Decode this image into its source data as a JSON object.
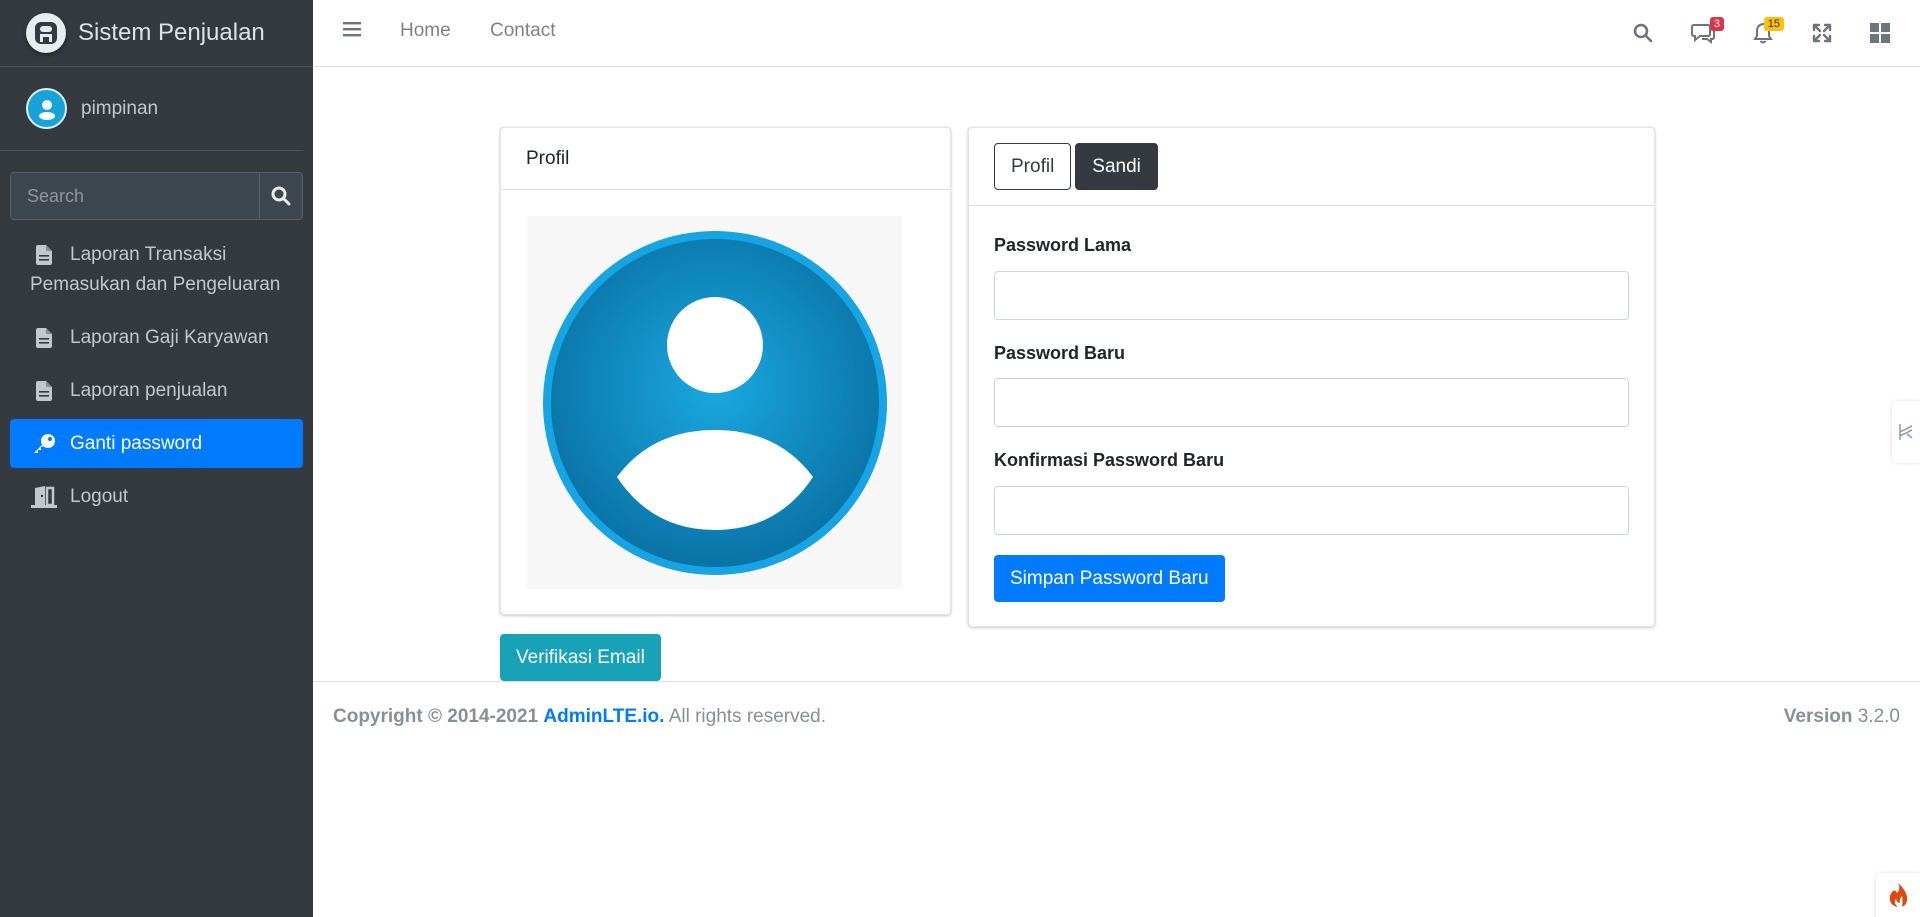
{
  "brand": {
    "title": "Sistem Penjualan",
    "logo_icon": "adminlte-logo-icon"
  },
  "user": {
    "name": "pimpinan",
    "avatar_icon": "user-avatar-icon"
  },
  "sidebar_search": {
    "placeholder": "Search"
  },
  "sidebar": {
    "items": [
      {
        "label_line1": "Laporan Transaksi",
        "label_line2": "Pemasukan dan Pengeluaran",
        "icon": "file-icon",
        "active": false
      },
      {
        "label": "Laporan Gaji Karyawan",
        "icon": "file-icon",
        "active": false
      },
      {
        "label": "Laporan penjualan",
        "icon": "file-icon",
        "active": false
      },
      {
        "label": "Ganti password",
        "icon": "key-icon",
        "active": true
      },
      {
        "label": "Logout",
        "icon": "door-exit-icon",
        "active": false
      }
    ]
  },
  "topbar": {
    "home": "Home",
    "contact": "Contact",
    "messages_badge": "3",
    "notifications_badge": "15"
  },
  "profile_card": {
    "title": "Profil"
  },
  "tabs": {
    "profil": "Profil",
    "sandi": "Sandi",
    "active": "Sandi"
  },
  "form": {
    "old_password_label": "Password Lama",
    "new_password_label": "Password Baru",
    "confirm_password_label": "Konfirmasi Password Baru",
    "old_password_value": "",
    "new_password_value": "",
    "confirm_password_value": "",
    "submit_label": "Simpan Password Baru"
  },
  "verify_email_label": "Verifikasi Email",
  "footer": {
    "copyright_prefix": "Copyright © 2014-2021",
    "link": "AdminLTE.io.",
    "suffix": "All rights reserved.",
    "version_label": "Version",
    "version_value": "3.2.0"
  },
  "colors": {
    "sidebar_bg": "#343a40",
    "primary": "#007bff",
    "info": "#17a2b8",
    "dark": "#343a40",
    "badge_danger": "#dc3545",
    "badge_warning": "#ffc107"
  }
}
